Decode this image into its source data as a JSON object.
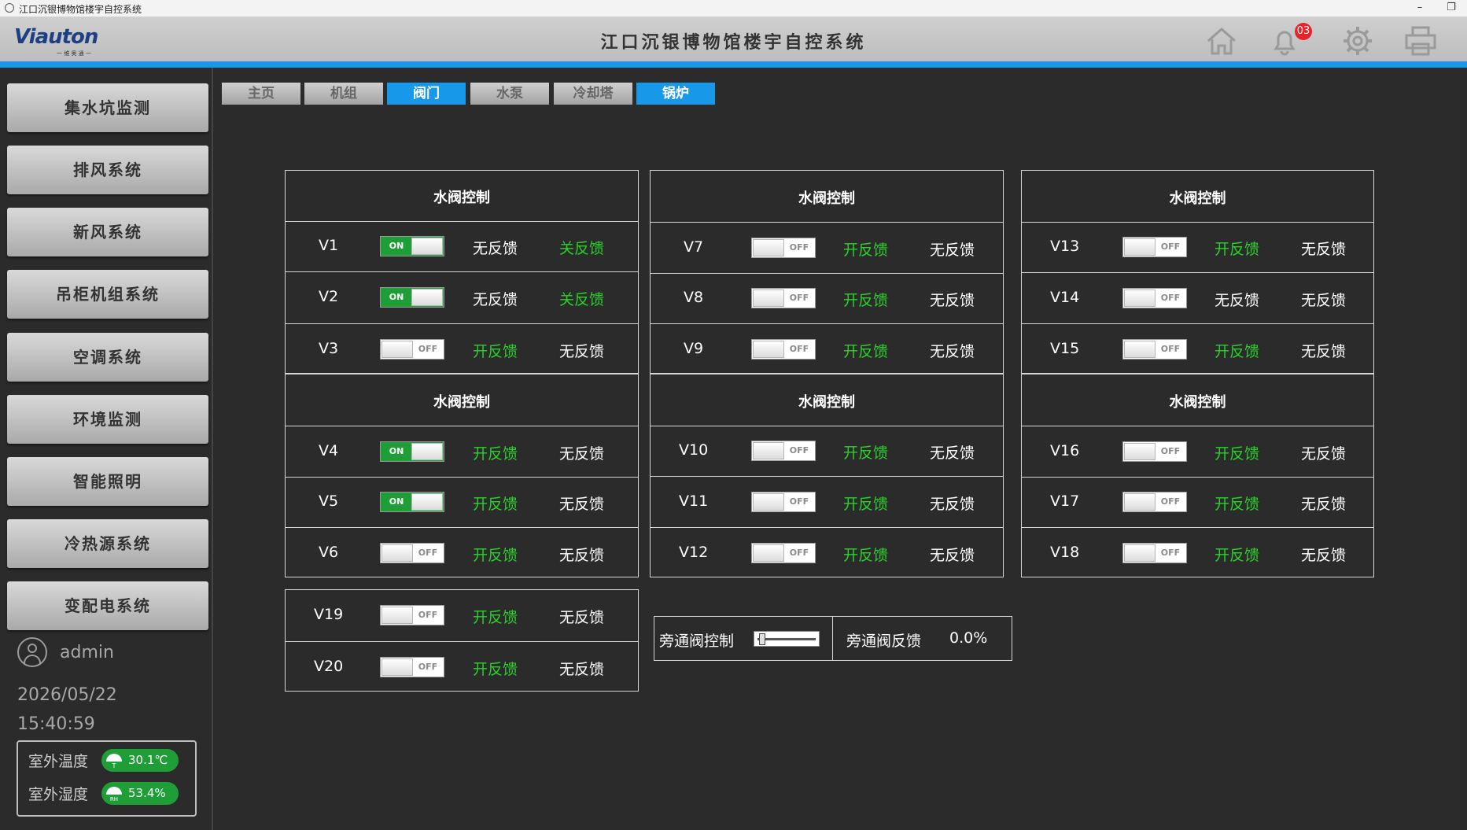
{
  "window": {
    "title": "江口沉银博物馆楼宇自控系统"
  },
  "header": {
    "logo_text": "Viauton",
    "logo_sub": "一 维 奥 通 一",
    "title": "江口沉银博物馆楼宇自控系统",
    "alert_count": "03"
  },
  "sidebar": {
    "items": [
      {
        "label": "集水坑监测"
      },
      {
        "label": "排风系统"
      },
      {
        "label": "新风系统"
      },
      {
        "label": "吊柜机组系统"
      },
      {
        "label": "空调系统"
      },
      {
        "label": "环境监测"
      },
      {
        "label": "智能照明"
      },
      {
        "label": "冷热源系统"
      },
      {
        "label": "变配电系统"
      }
    ],
    "user": "admin",
    "date": "2026/05/22",
    "time": "15:40:59",
    "outdoor_temp_label": "室外温度",
    "outdoor_temp": "30.1℃",
    "outdoor_humidity_label": "室外湿度",
    "outdoor_humidity": "53.4%",
    "humidity_icon_text": "RH",
    "temp_icon_text": "T"
  },
  "tabs": [
    {
      "label": "主页",
      "active": false
    },
    {
      "label": "机组",
      "active": false
    },
    {
      "label": "阀门",
      "active": true
    },
    {
      "label": "水泵",
      "active": false
    },
    {
      "label": "冷却塔",
      "active": false
    },
    {
      "label": "锅炉",
      "active": true
    }
  ],
  "toggle_text": {
    "on": "ON",
    "off": "OFF"
  },
  "panels": [
    {
      "title": "水阀控制",
      "valves": [
        {
          "name": "V1",
          "state": "on",
          "fb1": "无反馈",
          "fb1_color": "white",
          "fb2": "关反馈",
          "fb2_color": "green"
        },
        {
          "name": "V2",
          "state": "on",
          "fb1": "无反馈",
          "fb1_color": "white",
          "fb2": "关反馈",
          "fb2_color": "green"
        },
        {
          "name": "V3",
          "state": "off",
          "fb1": "开反馈",
          "fb1_color": "green",
          "fb2": "无反馈",
          "fb2_color": "white"
        }
      ]
    },
    {
      "title": "水阀控制",
      "valves": [
        {
          "name": "V7",
          "state": "off",
          "fb1": "开反馈",
          "fb1_color": "green",
          "fb2": "无反馈",
          "fb2_color": "white"
        },
        {
          "name": "V8",
          "state": "off",
          "fb1": "开反馈",
          "fb1_color": "green",
          "fb2": "无反馈",
          "fb2_color": "white"
        },
        {
          "name": "V9",
          "state": "off",
          "fb1": "开反馈",
          "fb1_color": "green",
          "fb2": "无反馈",
          "fb2_color": "white"
        }
      ]
    },
    {
      "title": "水阀控制",
      "valves": [
        {
          "name": "V13",
          "state": "off",
          "fb1": "开反馈",
          "fb1_color": "green",
          "fb2": "无反馈",
          "fb2_color": "white"
        },
        {
          "name": "V14",
          "state": "off",
          "fb1": "无反馈",
          "fb1_color": "white",
          "fb2": "无反馈",
          "fb2_color": "white"
        },
        {
          "name": "V15",
          "state": "off",
          "fb1": "开反馈",
          "fb1_color": "green",
          "fb2": "无反馈",
          "fb2_color": "white"
        }
      ]
    },
    {
      "title": "水阀控制",
      "valves": [
        {
          "name": "V4",
          "state": "on",
          "fb1": "开反馈",
          "fb1_color": "green",
          "fb2": "无反馈",
          "fb2_color": "white"
        },
        {
          "name": "V5",
          "state": "on",
          "fb1": "开反馈",
          "fb1_color": "green",
          "fb2": "无反馈",
          "fb2_color": "white"
        },
        {
          "name": "V6",
          "state": "off",
          "fb1": "开反馈",
          "fb1_color": "green",
          "fb2": "无反馈",
          "fb2_color": "white"
        }
      ]
    },
    {
      "title": "水阀控制",
      "valves": [
        {
          "name": "V10",
          "state": "off",
          "fb1": "开反馈",
          "fb1_color": "green",
          "fb2": "无反馈",
          "fb2_color": "white"
        },
        {
          "name": "V11",
          "state": "off",
          "fb1": "开反馈",
          "fb1_color": "green",
          "fb2": "无反馈",
          "fb2_color": "white"
        },
        {
          "name": "V12",
          "state": "off",
          "fb1": "开反馈",
          "fb1_color": "green",
          "fb2": "无反馈",
          "fb2_color": "white"
        }
      ]
    },
    {
      "title": "水阀控制",
      "valves": [
        {
          "name": "V16",
          "state": "off",
          "fb1": "开反馈",
          "fb1_color": "green",
          "fb2": "无反馈",
          "fb2_color": "white"
        },
        {
          "name": "V17",
          "state": "off",
          "fb1": "开反馈",
          "fb1_color": "green",
          "fb2": "无反馈",
          "fb2_color": "white"
        },
        {
          "name": "V18",
          "state": "off",
          "fb1": "开反馈",
          "fb1_color": "green",
          "fb2": "无反馈",
          "fb2_color": "white"
        }
      ]
    },
    {
      "title": "",
      "valves": [
        {
          "name": "V19",
          "state": "off",
          "fb1": "开反馈",
          "fb1_color": "green",
          "fb2": "无反馈",
          "fb2_color": "white"
        },
        {
          "name": "V20",
          "state": "off",
          "fb1": "开反馈",
          "fb1_color": "green",
          "fb2": "无反馈",
          "fb2_color": "white"
        }
      ]
    }
  ],
  "bypass": {
    "control_label": "旁通阀控制",
    "slider_level": 0.0,
    "feedback_label": "旁通阀反馈",
    "feedback_value": "0.0%"
  },
  "colors": {
    "accent": "#1798e8",
    "on": "#1f9e38",
    "feedback_green": "#2bd12b",
    "badge": "#e8232a"
  }
}
